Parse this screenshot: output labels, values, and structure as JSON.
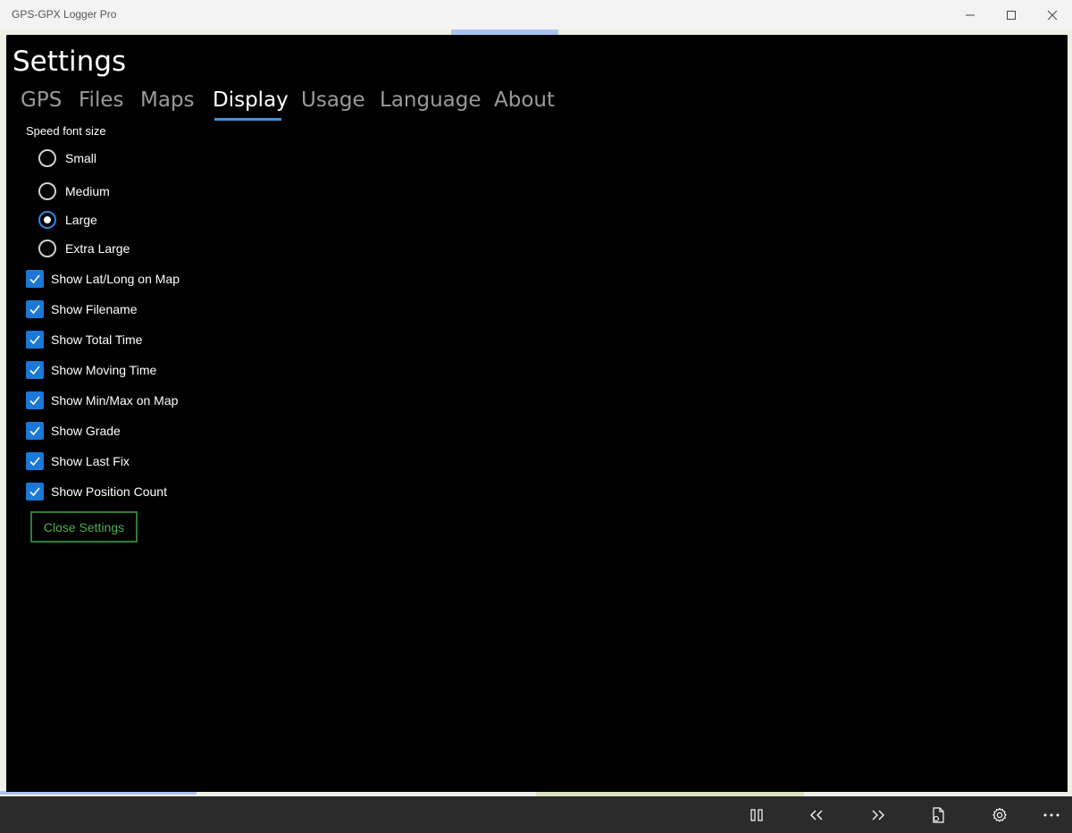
{
  "window": {
    "title": "GPS-GPX Logger Pro",
    "controls": [
      "minimize-icon",
      "maximize-icon",
      "close-icon"
    ]
  },
  "settings": {
    "title": "Settings",
    "tabs": [
      {
        "label": "GPS",
        "active": false
      },
      {
        "label": "Files",
        "active": false
      },
      {
        "label": "Maps",
        "active": false
      },
      {
        "label": "Display",
        "active": true
      },
      {
        "label": "Usage",
        "active": false
      },
      {
        "label": "Language",
        "active": false
      },
      {
        "label": "About",
        "active": false
      }
    ],
    "speed_font_size": {
      "label": "Speed font size",
      "options": [
        {
          "label": "Small",
          "checked": false
        },
        {
          "label": "Medium",
          "checked": false
        },
        {
          "label": "Large",
          "checked": true
        },
        {
          "label": "Extra Large",
          "checked": false
        }
      ]
    },
    "checkboxes": [
      {
        "label": "Show Lat/Long on Map",
        "checked": true
      },
      {
        "label": "Show Filename",
        "checked": true
      },
      {
        "label": "Show Total Time",
        "checked": true
      },
      {
        "label": "Show Moving Time",
        "checked": true
      },
      {
        "label": "Show Min/Max on Map",
        "checked": true
      },
      {
        "label": "Show Grade",
        "checked": true
      },
      {
        "label": "Show Last Fix",
        "checked": true
      },
      {
        "label": "Show Position Count",
        "checked": true
      }
    ],
    "close_button": "Close Settings"
  },
  "appbar": {
    "buttons": [
      "pause-icon",
      "previous-icon",
      "next-icon",
      "document-icon",
      "settings-gear-icon",
      "more-icon"
    ]
  },
  "colors": {
    "accent": "#1a78d6",
    "panel_background": "#000000",
    "close_button_border": "#2e7d32",
    "close_button_text": "#4caf50",
    "appbar_background": "#2b2b2b"
  }
}
